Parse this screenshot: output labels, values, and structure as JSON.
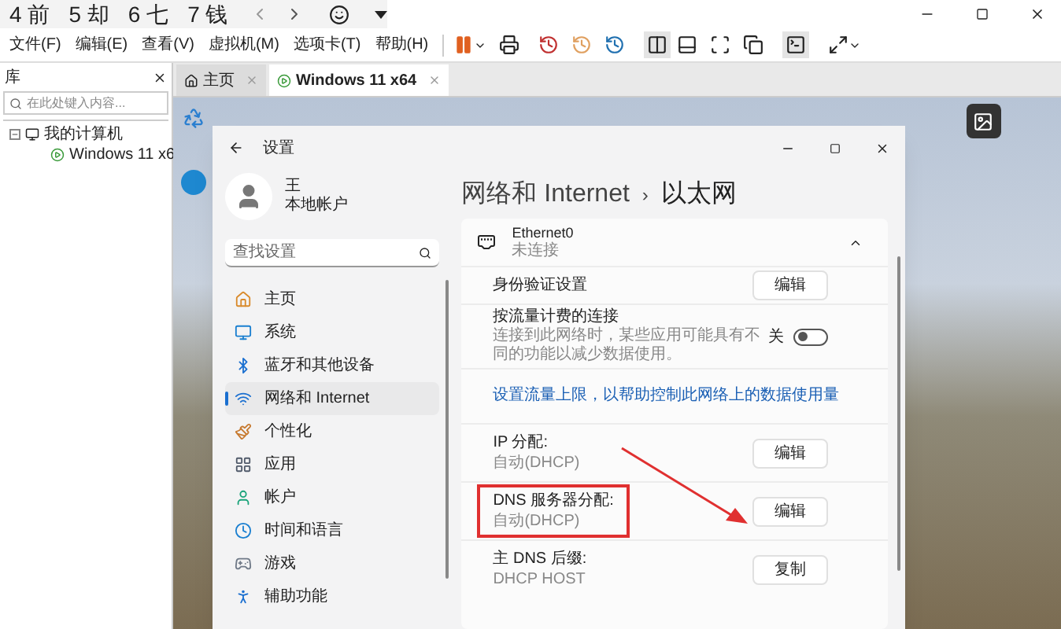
{
  "top_strip": [
    "4 前",
    "5 却",
    "6 七",
    "7 钱"
  ],
  "menu": [
    "文件(F)",
    "编辑(E)",
    "查看(V)",
    "虚拟机(M)",
    "选项卡(T)",
    "帮助(H)"
  ],
  "library": {
    "title": "库",
    "search_placeholder": "在此处键入内容...",
    "tree": [
      {
        "label": "我的计算机",
        "expanded": true,
        "children": [
          {
            "label": "Windows 11 x6"
          }
        ]
      }
    ]
  },
  "vm_tabs": [
    {
      "label": "主页",
      "selected": false
    },
    {
      "label": "Windows 11 x64",
      "selected": true
    }
  ],
  "settings": {
    "title": "设置",
    "user": {
      "name": "王",
      "account": "本地帐户"
    },
    "search_placeholder": "查找设置",
    "nav": [
      {
        "label": "主页",
        "selected": false
      },
      {
        "label": "系统",
        "selected": false
      },
      {
        "label": "蓝牙和其他设备",
        "selected": false
      },
      {
        "label": "网络和 Internet",
        "selected": true
      },
      {
        "label": "个性化",
        "selected": false
      },
      {
        "label": "应用",
        "selected": false
      },
      {
        "label": "帐户",
        "selected": false
      },
      {
        "label": "时间和语言",
        "selected": false
      },
      {
        "label": "游戏",
        "selected": false
      },
      {
        "label": "辅助功能",
        "selected": false
      }
    ],
    "breadcrumb": [
      "网络和 Internet",
      "以太网"
    ],
    "separator": "›",
    "adapter": {
      "name": "Ethernet0",
      "status": "未连接",
      "expanded": true
    },
    "rows": [
      {
        "kind": "button",
        "label": "身份验证设置",
        "button": "编辑",
        "highlighted": false
      },
      {
        "kind": "toggle",
        "label": "按流量计费的连接",
        "description": "连接到此网络时，某些应用可能具有不同的功能以减少数据使用。",
        "toggle_label": "关",
        "on": false
      },
      {
        "kind": "link",
        "label": "设置流量上限，以帮助控制此网络上的数据使用量"
      },
      {
        "kind": "button",
        "label": "IP 分配:",
        "value": "自动(DHCP)",
        "button": "编辑",
        "highlighted": false
      },
      {
        "kind": "button",
        "label": "DNS 服务器分配:",
        "value": "自动(DHCP)",
        "button": "编辑",
        "highlighted": true
      },
      {
        "kind": "button",
        "label": "主 DNS 后缀:",
        "value": "DHCP HOST",
        "button": "复制",
        "highlighted": false
      }
    ]
  }
}
